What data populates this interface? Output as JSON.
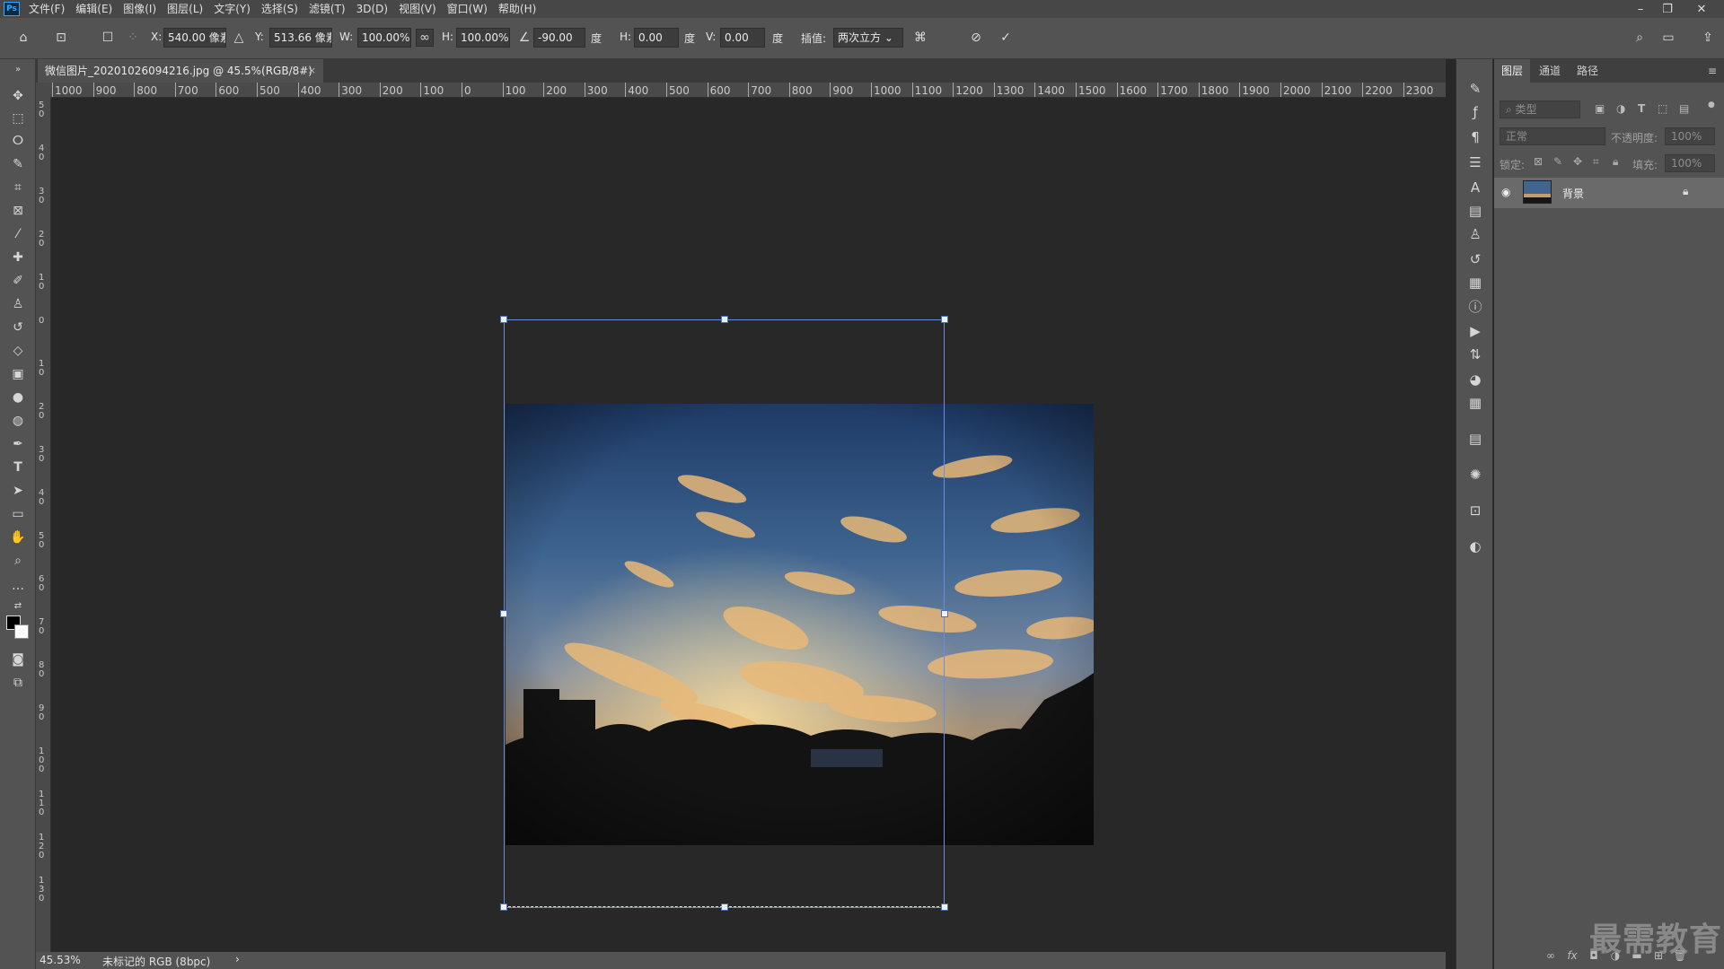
{
  "app": {
    "logo": "Ps"
  },
  "menu": [
    "文件(F)",
    "编辑(E)",
    "图像(I)",
    "图层(L)",
    "文字(Y)",
    "选择(S)",
    "滤镜(T)",
    "3D(D)",
    "视图(V)",
    "窗口(W)",
    "帮助(H)"
  ],
  "window_controls": {
    "minimize": "–",
    "restore": "❐",
    "close": "✕"
  },
  "options": {
    "x_label": "X:",
    "x_value": "540.00 像素",
    "y_label": "Y:",
    "y_value": "513.66 像素",
    "w_label": "W:",
    "w_value": "100.00%",
    "h_label": "H:",
    "h_value": "100.00%",
    "angle_value": "-90.00",
    "angle_unit": "度",
    "skew_h_label": "H:",
    "skew_h_value": "0.00",
    "skew_h_unit": "度",
    "skew_v_label": "V:",
    "skew_v_value": "0.00",
    "skew_v_unit": "度",
    "interp_label": "插值:",
    "interp_value": "两次立方",
    "cancel_icon": "⃠",
    "commit_icon": "✓"
  },
  "document": {
    "tab_title": "微信图片_20201026094216.jpg @ 45.5%(RGB/8#)",
    "close": "×"
  },
  "ruler_h": [
    "1000",
    "900",
    "800",
    "700",
    "600",
    "500",
    "400",
    "300",
    "200",
    "100",
    "0",
    "100",
    "200",
    "300",
    "400",
    "500",
    "600",
    "700",
    "800",
    "900",
    "1000",
    "1100",
    "1200",
    "1300",
    "1400",
    "1500",
    "1600",
    "1700",
    "1800",
    "1900",
    "2000",
    "2100",
    "2200",
    "2300"
  ],
  "ruler_v": [
    "50",
    "40",
    "30",
    "20",
    "10",
    "0",
    "10",
    "20",
    "30",
    "40",
    "50",
    "60",
    "70",
    "80",
    "90",
    "100",
    "110",
    "120",
    "130"
  ],
  "status": {
    "zoom": "45.53%",
    "profile": "未标记的 RGB (8bpc)",
    "arrow": "›"
  },
  "layers_panel": {
    "tabs": [
      "图层",
      "通道",
      "路径"
    ],
    "filter_placeholder": "类型",
    "blend_mode": "正常",
    "opacity_label": "不透明度:",
    "opacity_value": "100%",
    "lock_label": "锁定:",
    "fill_label": "填充:",
    "fill_value": "100%",
    "layer_name": "背景"
  },
  "watermark": "最需教育",
  "colors": {
    "accent": "#31a8ff",
    "transform": "#6b8cd9"
  }
}
